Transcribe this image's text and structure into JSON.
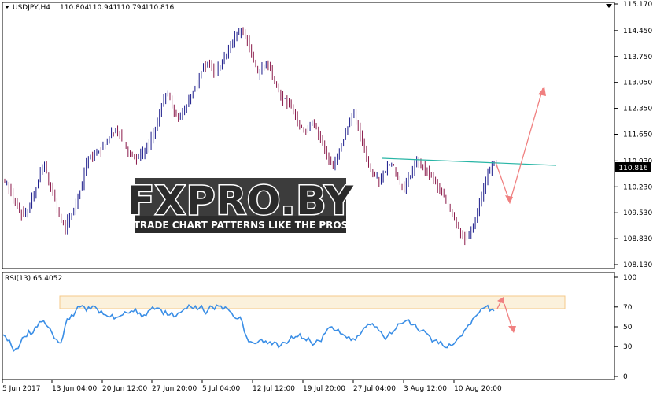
{
  "main_chart": {
    "symbol_label": "USDJPY,H4",
    "ohlc": {
      "open": "110.804",
      "high": "110.941",
      "low": "110.794",
      "close": "110.816"
    },
    "current_price": "110.816",
    "price_ticks": [
      "115.170",
      "114.450",
      "113.750",
      "113.050",
      "112.350",
      "111.650",
      "110.930",
      "110.230",
      "109.530",
      "108.830",
      "108.130"
    ],
    "watermark": {
      "logo_text": "FXPRO.BY",
      "tagline": "TRADE CHART PATTERNS LIKE THE PROS"
    }
  },
  "rsi": {
    "label": "RSI(13) 65.4052",
    "ticks": [
      "100",
      "70",
      "50",
      "30",
      "0"
    ]
  },
  "time_axis": {
    "labels": [
      "5 Jun 2017",
      "13 Jun 04:00",
      "20 Jun 12:00",
      "27 Jun 20:00",
      "5 Jul 04:00",
      "12 Jul 12:00",
      "19 Jul 20:00",
      "27 Jul 04:00",
      "3 Aug 12:00",
      "10 Aug 20:00"
    ]
  },
  "colors": {
    "bull_candle": "#1a1a8a",
    "bear_candle": "#8a1a4a",
    "trendline": "#27b5a5",
    "arrow": "#f08080",
    "rsi_line": "#3a8ee6",
    "rsi_zone": "#f5c98a"
  },
  "chart_data": {
    "type": "candlestick",
    "price_series": [
      110.35,
      110.05,
      109.8,
      109.6,
      109.45,
      109.55,
      109.9,
      110.2,
      110.6,
      110.8,
      110.35,
      110.1,
      109.6,
      109.3,
      109.1,
      109.4,
      109.6,
      110.0,
      110.3,
      110.9,
      111.05,
      111.1,
      111.2,
      111.3,
      111.45,
      111.7,
      111.8,
      111.65,
      111.4,
      111.2,
      111.05,
      111.0,
      111.1,
      111.2,
      111.4,
      111.7,
      112.0,
      112.4,
      112.7,
      112.6,
      112.3,
      112.1,
      112.2,
      112.4,
      112.7,
      112.9,
      113.2,
      113.5,
      113.6,
      113.45,
      113.3,
      113.5,
      113.7,
      113.9,
      114.1,
      114.35,
      114.45,
      114.3,
      114.0,
      113.6,
      113.3,
      113.45,
      113.6,
      113.4,
      113.0,
      112.8,
      112.6,
      112.5,
      112.35,
      112.1,
      111.9,
      111.75,
      111.8,
      112.0,
      111.8,
      111.5,
      111.2,
      110.9,
      110.8,
      111.1,
      111.4,
      111.7,
      112.0,
      112.2,
      111.8,
      111.4,
      111.0,
      110.7,
      110.5,
      110.4,
      110.6,
      110.8,
      110.85,
      110.6,
      110.3,
      110.2,
      110.5,
      110.7,
      110.9,
      110.8,
      110.7,
      110.6,
      110.4,
      110.2,
      110.0,
      109.85,
      109.6,
      109.4,
      109.1,
      108.9,
      108.85,
      109.0,
      109.4,
      109.8,
      110.2,
      110.6,
      110.8,
      110.816
    ],
    "rsi_series": [
      42,
      36,
      30,
      28,
      33,
      40,
      46,
      44,
      50,
      55,
      52,
      48,
      38,
      34,
      40,
      58,
      62,
      66,
      70,
      70,
      70,
      71,
      68,
      66,
      62,
      60,
      58,
      60,
      62,
      64,
      66,
      68,
      64,
      62,
      66,
      70,
      69,
      67,
      66,
      62,
      60,
      64,
      66,
      68,
      70,
      71,
      69,
      66,
      67,
      70,
      72,
      71,
      70,
      66,
      60,
      58,
      55,
      40,
      35,
      33,
      36,
      34,
      33,
      32,
      34,
      31,
      34,
      36,
      38,
      40,
      38,
      36,
      35,
      33,
      36,
      42,
      48,
      50,
      46,
      43,
      41,
      40,
      38,
      41,
      45,
      50,
      52,
      50,
      46,
      41,
      40,
      43,
      48,
      53,
      55,
      57,
      52,
      48,
      46,
      44,
      40,
      36,
      33,
      31,
      29,
      31,
      35,
      40,
      46,
      52,
      58,
      62,
      68,
      70,
      66,
      66
    ],
    "rsi_zone": [
      66,
      80
    ],
    "price_axis_range": [
      108.13,
      115.17
    ],
    "rsi_axis_range": [
      0,
      100
    ]
  }
}
